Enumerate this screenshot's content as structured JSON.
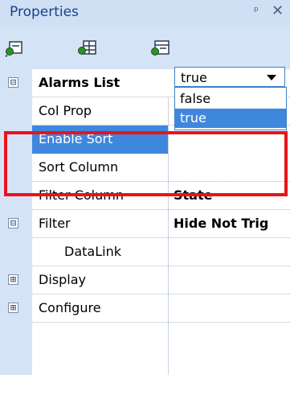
{
  "window": {
    "title": "Properties",
    "pin_glyph": "ᵖ",
    "close_glyph": "✕"
  },
  "toolbar": [
    {
      "icon": "categorized-view-icon"
    },
    {
      "icon": "alphabetical-view-icon"
    },
    {
      "icon": "property-pages-icon"
    }
  ],
  "grid": {
    "alarms": {
      "expander": "⊟",
      "label": "Alarms List"
    },
    "col_prop": {
      "label": "Col Prop",
      "value": ""
    },
    "enable_sort": {
      "label": "Enable Sort",
      "value": "true"
    },
    "sort_column": {
      "label": "Sort Column",
      "value": ""
    },
    "filter_column": {
      "label": "Filter Column",
      "value": "State"
    },
    "filter": {
      "expander": "⊟",
      "label": "Filter",
      "value": "Hide Not Trig"
    },
    "datalink": {
      "label": "DataLink",
      "value": ""
    },
    "display": {
      "expander": "⊞",
      "label": "Display"
    },
    "configure": {
      "expander": "⊞",
      "label": "Configure"
    }
  },
  "dropdown": {
    "selected": "true",
    "options": [
      "false",
      "true"
    ],
    "highlighted_index": 1
  },
  "colors": {
    "selection": "#3f87dc",
    "annotation": "#e8141a",
    "header": "#15428b"
  }
}
